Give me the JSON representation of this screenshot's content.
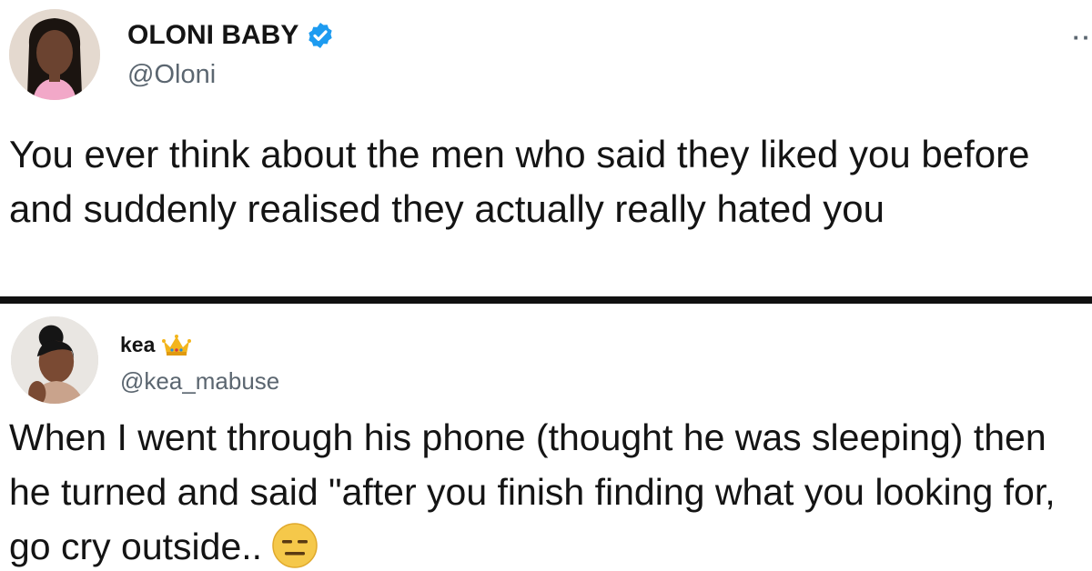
{
  "tweets": [
    {
      "display_name": "OLONI BABY",
      "verified": true,
      "handle": "@Oloni",
      "more_label": "··",
      "text": "You ever think about the men who said they liked you before and suddenly realised they actually really hated you"
    },
    {
      "display_name": "kea",
      "name_emoji": "crown-icon",
      "handle": "@kea_mabuse",
      "text": "When I went through his phone (thought he was sleeping) then he turned and said \"after you finish finding what you looking for, go cry outside..",
      "trailing_emoji": "expressionless-face-icon"
    }
  ],
  "colors": {
    "verified_blue": "#1d9bf0",
    "handle_gray": "#5b6670",
    "divider": "#111111",
    "emoji_yellow": "#f5c84a"
  }
}
